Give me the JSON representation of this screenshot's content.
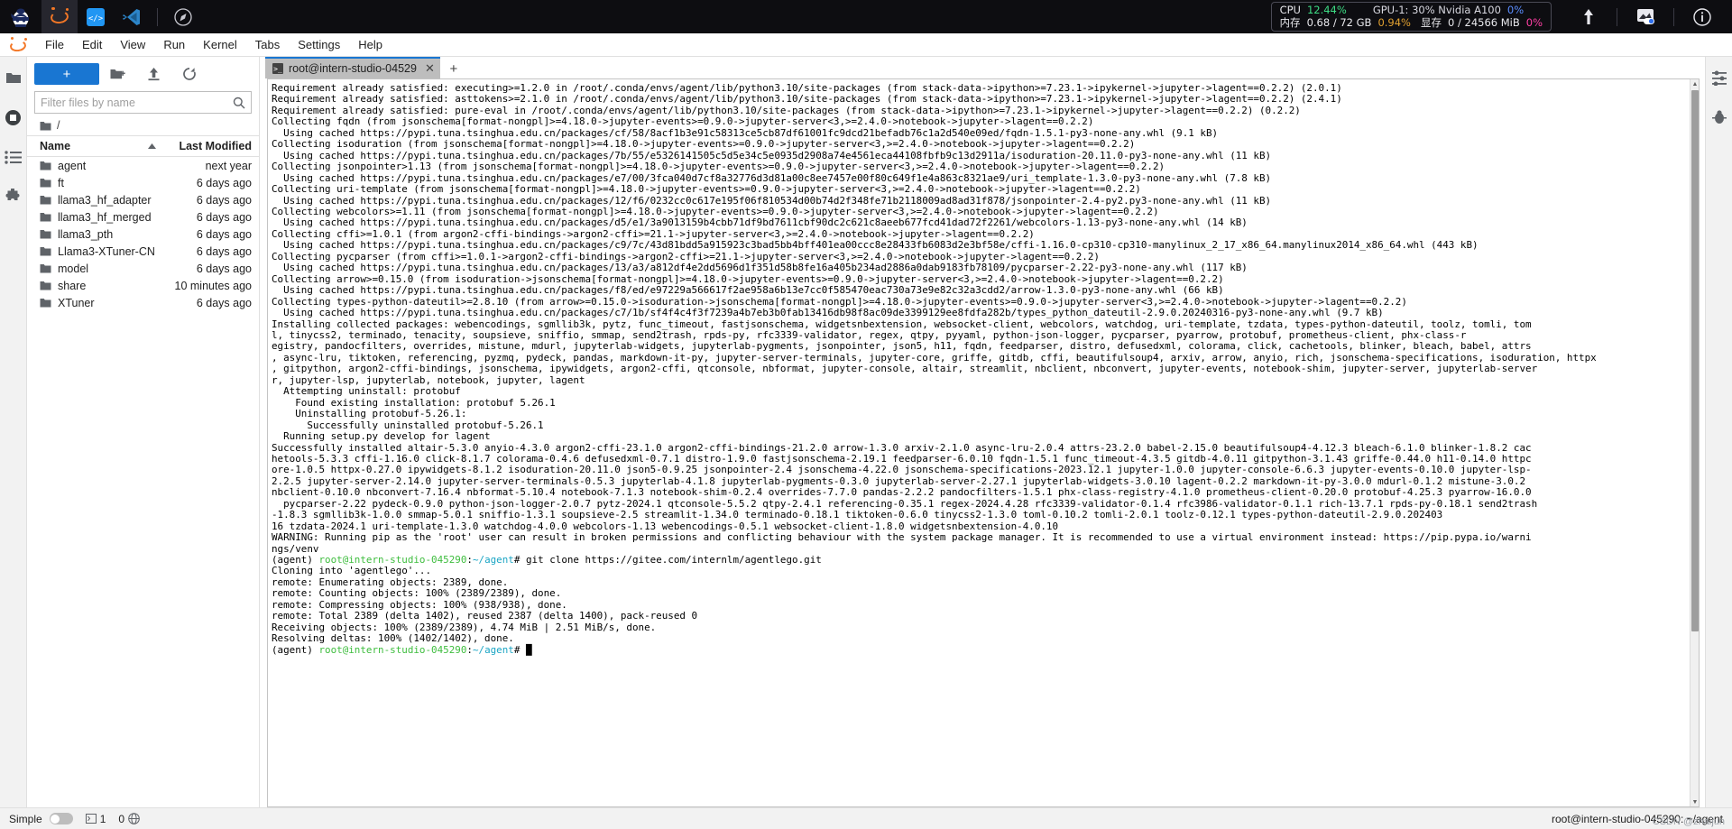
{
  "osbar": {
    "apps": [
      {
        "name": "ninja-app-icon",
        "label": ""
      },
      {
        "name": "jupyter-app-icon",
        "label": ""
      },
      {
        "name": "code-app-icon",
        "label": ""
      },
      {
        "name": "vscode-app-icon",
        "label": ""
      },
      {
        "name": "compass-app-icon",
        "label": ""
      }
    ],
    "stats": {
      "cpu_label": "CPU",
      "cpu_value": "12.44%",
      "gpu_label": "GPU-1: 30% Nvidia A100",
      "gpu_value": "0%",
      "mem_label": "内存",
      "mem_value": "0.68 / 72 GB",
      "mem_pct": "0.94%",
      "vram_label": "显存",
      "vram_value": "0 / 24566 MiB",
      "vram_pct": "0%"
    },
    "tools": [
      {
        "name": "upload-arrow-icon"
      },
      {
        "name": "theme-toggle-icon"
      },
      {
        "name": "info-icon"
      }
    ]
  },
  "menubar": {
    "items": [
      "File",
      "Edit",
      "View",
      "Run",
      "Kernel",
      "Tabs",
      "Settings",
      "Help"
    ]
  },
  "left_rail": [
    {
      "name": "sidebar-item-file-browser",
      "icon": "folder-icon"
    },
    {
      "name": "sidebar-item-running",
      "icon": "stop-circle-icon"
    },
    {
      "name": "sidebar-item-commands",
      "icon": "list-icon"
    },
    {
      "name": "sidebar-item-extensions",
      "icon": "puzzle-icon"
    }
  ],
  "right_rail": [
    {
      "name": "sidebar-item-property-inspector",
      "icon": "sliders-icon"
    },
    {
      "name": "sidebar-item-debugger",
      "icon": "bug-icon"
    }
  ],
  "filebrowser": {
    "new_button": "+",
    "toolbar_icons": [
      {
        "name": "new-folder-icon"
      },
      {
        "name": "upload-icon"
      },
      {
        "name": "refresh-icon"
      }
    ],
    "filter_placeholder": "Filter files by name",
    "breadcrumb": "/",
    "columns": {
      "name": "Name",
      "modified": "Last Modified"
    },
    "sort_direction": "ascending",
    "rows": [
      {
        "name": "agent",
        "modified": "next year"
      },
      {
        "name": "ft",
        "modified": "6 days ago"
      },
      {
        "name": "llama3_hf_adapter",
        "modified": "6 days ago"
      },
      {
        "name": "llama3_hf_merged",
        "modified": "6 days ago"
      },
      {
        "name": "llama3_pth",
        "modified": "6 days ago"
      },
      {
        "name": "Llama3-XTuner-CN",
        "modified": "6 days ago"
      },
      {
        "name": "model",
        "modified": "6 days ago"
      },
      {
        "name": "share",
        "modified": "10 minutes ago"
      },
      {
        "name": "XTuner",
        "modified": "6 days ago"
      }
    ]
  },
  "tabs": {
    "items": [
      {
        "label": "root@intern-studio-04529",
        "close": "✕"
      }
    ],
    "add_label": "+"
  },
  "terminal": {
    "lines_plain": "Requirement already satisfied: executing>=1.2.0 in /root/.conda/envs/agent/lib/python3.10/site-packages (from stack-data->ipython>=7.23.1->ipykernel->jupyter->lagent==0.2.2) (2.0.1)\nRequirement already satisfied: asttokens>=2.1.0 in /root/.conda/envs/agent/lib/python3.10/site-packages (from stack-data->ipython>=7.23.1->ipykernel->jupyter->lagent==0.2.2) (2.4.1)\nRequirement already satisfied: pure-eval in /root/.conda/envs/agent/lib/python3.10/site-packages (from stack-data->ipython>=7.23.1->ipykernel->jupyter->lagent==0.2.2) (0.2.2)\nCollecting fqdn (from jsonschema[format-nongpl]>=4.18.0->jupyter-events>=0.9.0->jupyter-server<3,>=2.4.0->notebook->jupyter->lagent==0.2.2)\n  Using cached https://pypi.tuna.tsinghua.edu.cn/packages/cf/58/8acf1b3e91c58313ce5cb87df61001fc9dcd21befadb76c1a2d540e09ed/fqdn-1.5.1-py3-none-any.whl (9.1 kB)\nCollecting isoduration (from jsonschema[format-nongpl]>=4.18.0->jupyter-events>=0.9.0->jupyter-server<3,>=2.4.0->notebook->jupyter->lagent==0.2.2)\n  Using cached https://pypi.tuna.tsinghua.edu.cn/packages/7b/55/e5326141505c5d5e34c5e0935d2908a74e4561eca44108fbfb9c13d2911a/isoduration-20.11.0-py3-none-any.whl (11 kB)\nCollecting jsonpointer>1.13 (from jsonschema[format-nongpl]>=4.18.0->jupyter-events>=0.9.0->jupyter-server<3,>=2.4.0->notebook->jupyter->lagent==0.2.2)\n  Using cached https://pypi.tuna.tsinghua.edu.cn/packages/e7/00/3fca040d7cf8a32776d3d81a00c8ee7457e00f80c649f1e4a863c8321ae9/uri_template-1.3.0-py3-none-any.whl (7.8 kB)\nCollecting uri-template (from jsonschema[format-nongpl]>=4.18.0->jupyter-events>=0.9.0->jupyter-server<3,>=2.4.0->notebook->jupyter->lagent==0.2.2)\n  Using cached https://pypi.tuna.tsinghua.edu.cn/packages/12/f6/0232cc0c617e195f06f810534d00b74d2f348fe71b2118009ad8ad31f878/jsonpointer-2.4-py2.py3-none-any.whl (11 kB)\nCollecting webcolors>=1.11 (from jsonschema[format-nongpl]>=4.18.0->jupyter-events>=0.9.0->jupyter-server<3,>=2.4.0->notebook->jupyter->lagent==0.2.2)\n  Using cached https://pypi.tuna.tsinghua.edu.cn/packages/d5/e1/3a9013159b4cbb71df9bd7611cbf90dc2c621c8aeeb677fcd41dad72f2261/webcolors-1.13-py3-none-any.whl (14 kB)\nCollecting cffi>=1.0.1 (from argon2-cffi-bindings->argon2-cffi>=21.1->jupyter-server<3,>=2.4.0->notebook->jupyter->lagent==0.2.2)\n  Using cached https://pypi.tuna.tsinghua.edu.cn/packages/c9/7c/43d81bdd5a915923c3bad5bb4bff401ea00ccc8e28433fb6083d2e3bf58e/cffi-1.16.0-cp310-cp310-manylinux_2_17_x86_64.manylinux2014_x86_64.whl (443 kB)\nCollecting pycparser (from cffi>=1.0.1->argon2-cffi-bindings->argon2-cffi>=21.1->jupyter-server<3,>=2.4.0->notebook->jupyter->lagent==0.2.2)\n  Using cached https://pypi.tuna.tsinghua.edu.cn/packages/13/a3/a812df4e2dd5696d1f351d58b8fe16a405b234ad2886a0dab9183fb78109/pycparser-2.22-py3-none-any.whl (117 kB)\nCollecting arrow>=0.15.0 (from isoduration->jsonschema[format-nongpl]>=4.18.0->jupyter-events>=0.9.0->jupyter-server<3,>=2.4.0->notebook->jupyter->lagent==0.2.2)\n  Using cached https://pypi.tuna.tsinghua.edu.cn/packages/f8/ed/e97229a566617f2ae958a6b13e7cc0f585470eac730a73e9e82c32a3cdd2/arrow-1.3.0-py3-none-any.whl (66 kB)\nCollecting types-python-dateutil>=2.8.10 (from arrow>=0.15.0->isoduration->jsonschema[format-nongpl]>=4.18.0->jupyter-events>=0.9.0->jupyter-server<3,>=2.4.0->notebook->jupyter->lagent==0.2.2)\n  Using cached https://pypi.tuna.tsinghua.edu.cn/packages/c7/1b/sf4f4c4f3f7239a4b7eb3b0fab13416db98f8ac09de3399129ee8fdfa282b/types_python_dateutil-2.9.0.20240316-py3-none-any.whl (9.7 kB)\nInstalling collected packages: webencodings, sgmllib3k, pytz, func_timeout, fastjsonschema, widgetsnbextension, websocket-client, webcolors, watchdog, uri-template, tzdata, types-python-dateutil, toolz, tomli, tom\nl, tinycss2, terminado, tenacity, soupsieve, sniffio, smmap, send2trash, rpds-py, rfc3339-validator, regex, qtpy, pyyaml, python-json-logger, pycparser, pyarrow, protobuf, prometheus-client, phx-class-r\negistry, pandocfilters, overrides, mistune, mdurl, jupyterlab-widgets, jupyterlab-pygments, jsonpointer, json5, h11, fqdn, feedparser, distro, defusedxml, colorama, click, cachetools, blinker, bleach, babel, attrs\n, async-lru, tiktoken, referencing, pyzmq, pydeck, pandas, markdown-it-py, jupyter-server-terminals, jupyter-core, griffe, gitdb, cffi, beautifulsoup4, arxiv, arrow, anyio, rich, jsonschema-specifications, isoduration, httpx\n, gitpython, argon2-cffi-bindings, jsonschema, ipywidgets, argon2-cffi, qtconsole, nbformat, jupyter-console, altair, streamlit, nbclient, nbconvert, jupyter-events, notebook-shim, jupyter-server, jupyterlab-server\nr, jupyter-lsp, jupyterlab, notebook, jupyter, lagent\n  Attempting uninstall: protobuf\n    Found existing installation: protobuf 5.26.1\n    Uninstalling protobuf-5.26.1:\n      Successfully uninstalled protobuf-5.26.1\n  Running setup.py develop for lagent\nSuccessfully installed altair-5.3.0 anyio-4.3.0 argon2-cffi-23.1.0 argon2-cffi-bindings-21.2.0 arrow-1.3.0 arxiv-2.1.0 async-lru-2.0.4 attrs-23.2.0 babel-2.15.0 beautifulsoup4-4.12.3 bleach-6.1.0 blinker-1.8.2 cac\nhetools-5.3.3 cffi-1.16.0 click-8.1.7 colorama-0.4.6 defusedxml-0.7.1 distro-1.9.0 fastjsonschema-2.19.1 feedparser-6.0.10 fqdn-1.5.1 func_timeout-4.3.5 gitdb-4.0.11 gitpython-3.1.43 griffe-0.44.0 h11-0.14.0 httpc\nore-1.0.5 httpx-0.27.0 ipywidgets-8.1.2 isoduration-20.11.0 json5-0.9.25 jsonpointer-2.4 jsonschema-4.22.0 jsonschema-specifications-2023.12.1 jupyter-1.0.0 jupyter-console-6.6.3 jupyter-events-0.10.0 jupyter-lsp-\n2.2.5 jupyter-server-2.14.0 jupyter-server-terminals-0.5.3 jupyterlab-4.1.8 jupyterlab-pygments-0.3.0 jupyterlab-server-2.27.1 jupyterlab-widgets-3.0.10 lagent-0.2.2 markdown-it-py-3.0.0 mdurl-0.1.2 mistune-3.0.2\nnbclient-0.10.0 nbconvert-7.16.4 nbformat-5.10.4 notebook-7.1.3 notebook-shim-0.2.4 overrides-7.7.0 pandas-2.2.2 pandocfilters-1.5.1 phx-class-registry-4.1.0 prometheus-client-0.20.0 protobuf-4.25.3 pyarrow-16.0.0\n  pycparser-2.22 pydeck-0.9.0 python-json-logger-2.0.7 pytz-2024.1 qtconsole-5.5.2 qtpy-2.4.1 referencing-0.35.1 regex-2024.4.28 rfc3339-validator-0.1.4 rfc3986-validator-0.1.1 rich-13.7.1 rpds-py-0.18.1 send2trash\n-1.8.3 sgmllib3k-1.0.0 smmap-5.0.1 sniffio-1.3.1 soupsieve-2.5 streamlit-1.34.0 terminado-0.18.1 tiktoken-0.6.0 tinycss2-1.3.0 toml-0.10.2 tomli-2.0.1 toolz-0.12.1 types-python-dateutil-2.9.0.202403\n16 tzdata-2024.1 uri-template-1.3.0 watchdog-4.0.0 webcolors-1.13 webencodings-0.5.1 websocket-client-1.8.0 widgetsnbextension-4.0.10",
    "warning_line1": "WARNING: Running pip as the 'root' user can result in broken permissions and conflicting behaviour with the system package manager. It is recommended to use a virtual environment instead: https://pip.pypa.io/warni",
    "warning_line2": "ngs/venv",
    "prompt1_env": "(agent) ",
    "prompt1_user": "root@intern-studio-045290",
    "prompt1_colon": ":",
    "prompt1_path": "~/agent",
    "prompt1_cmd": "# git clone https://gitee.com/internlm/agentlego.git",
    "git_output": "Cloning into 'agentlego'...\nremote: Enumerating objects: 2389, done.\nremote: Counting objects: 100% (2389/2389), done.\nremote: Compressing objects: 100% (938/938), done.\nremote: Total 2389 (delta 1402), reused 2387 (delta 1400), pack-reused 0\nReceiving objects: 100% (2389/2389), 4.74 MiB | 2.51 MiB/s, done.\nResolving deltas: 100% (1402/1402), done.",
    "prompt2_env": "(agent) ",
    "prompt2_user": "root@intern-studio-045290",
    "prompt2_colon": ":",
    "prompt2_path": "~/agent",
    "prompt2_cmd": "# ",
    "cursor": "█"
  },
  "statusbar": {
    "mode_label": "Simple",
    "terminals_count": "1",
    "kernels_count": "0",
    "right_text": "root@intern-studio-045290: ~/agent",
    "watermark": "CSDN @zhaijun"
  },
  "colors": {
    "accent_blue": "#1976d2",
    "jupyter_orange": "#f37726",
    "term_yellow": "#b8860b",
    "term_green": "#3ebd3e",
    "term_cyan": "#1ba5c4",
    "cpu_green": "#3ddc84",
    "mem_orange": "#e0a030",
    "gpu_blue": "#5b8dff",
    "vram_pink": "#ff3fa4"
  }
}
